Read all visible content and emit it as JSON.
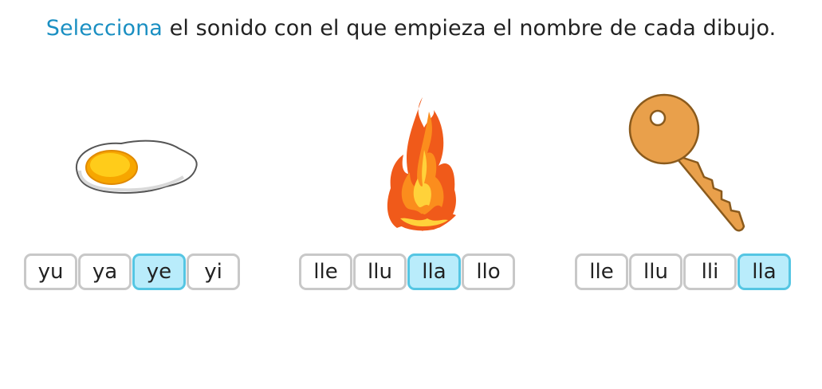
{
  "instruction": {
    "highlight": "Selecciona",
    "rest": " el sonido con el que empieza el nombre de cada dibujo."
  },
  "colors": {
    "highlight": "#1a8fc2",
    "selected_fill": "#b9ecfb",
    "selected_border": "#55c6e3",
    "option_border": "#c8c8c8"
  },
  "items": [
    {
      "picture": "fried-egg-icon",
      "options": [
        "yu",
        "ya",
        "ye",
        "yi"
      ],
      "selected": "ye"
    },
    {
      "picture": "fire-icon",
      "options": [
        "lle",
        "llu",
        "lla",
        "llo"
      ],
      "selected": "lla"
    },
    {
      "picture": "key-icon",
      "options": [
        "lle",
        "llu",
        "lli",
        "lla"
      ],
      "selected": "lla"
    }
  ]
}
